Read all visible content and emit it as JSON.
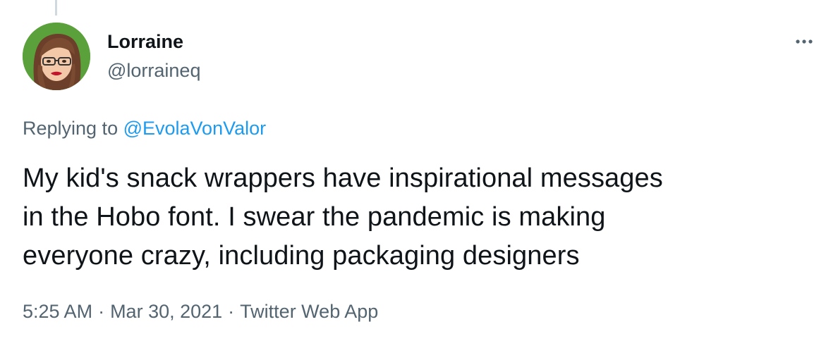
{
  "thread": {
    "has_line_above": true
  },
  "author": {
    "display_name": "Lorraine",
    "handle": "@lorraineq",
    "avatar_background": "#5aa13b"
  },
  "more_icon": "more-horizontal-icon",
  "reply": {
    "prefix": "Replying to ",
    "mention": "@EvolaVonValor"
  },
  "tweet": {
    "lines": [
      "My kid's snack wrappers have inspirational messages",
      "in the Hobo font. I swear the pandemic is making",
      "everyone crazy, including packaging designers"
    ]
  },
  "meta": {
    "time": "5:25 AM",
    "date": "Mar 30, 2021",
    "source": "Twitter Web App",
    "separator": "·"
  },
  "colors": {
    "text_primary": "#0f1419",
    "text_secondary": "#536471",
    "link": "#1d9bf0",
    "thread_line": "#cfd9de"
  }
}
